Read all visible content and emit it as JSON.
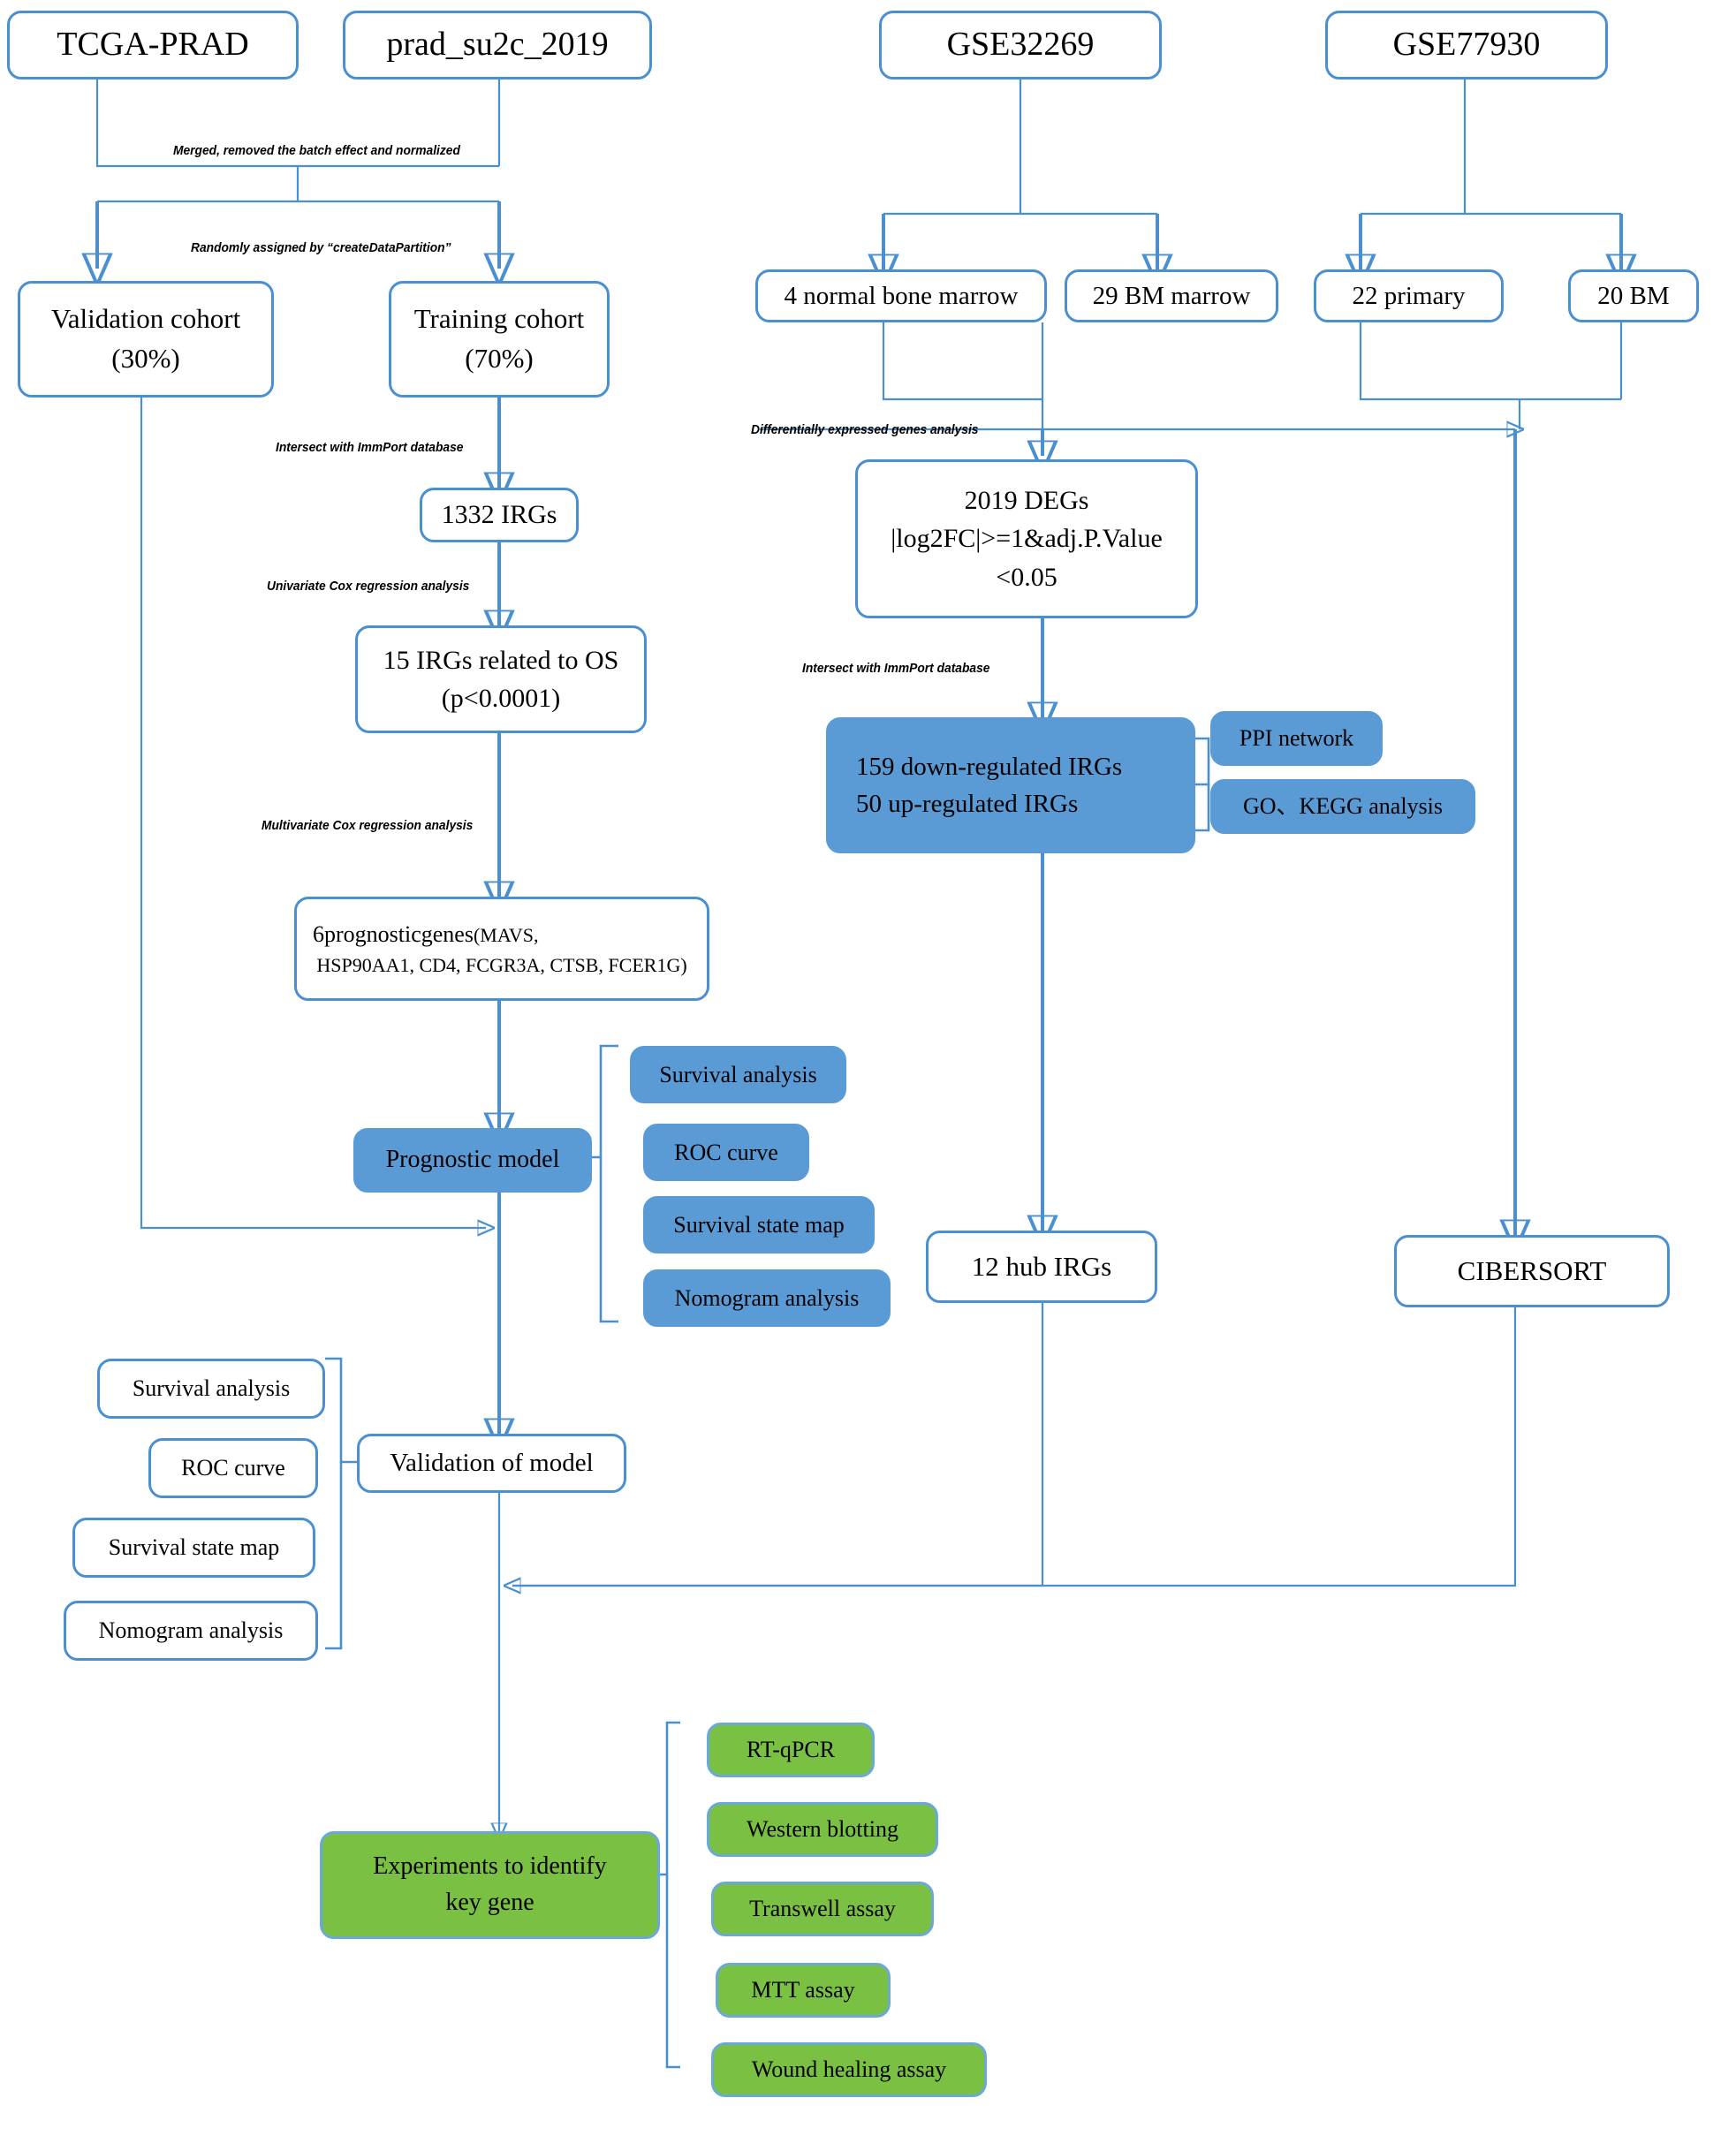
{
  "diagram": {
    "title": "Immune-related gene prognostic model workflow",
    "colors": {
      "connector": "#4a8fd0",
      "blue_box": "#5b9bd5",
      "green_box": "#7ac143",
      "white_box": "#ffffff",
      "text": "#000000"
    }
  },
  "sources": {
    "tcga_prad": "TCGA-PRAD",
    "prad_su2c_2019": "prad_su2c_2019",
    "gse32269": "GSE32269",
    "gse77930": "GSE77930"
  },
  "edge_labels": {
    "merged": "Merged, removed the batch effect and normalized",
    "random_partition": "Randomly assigned by “createDataPartition”",
    "intersect_immport_left": "Intersect with ImmPort database",
    "univariate_cox": "Univariate Cox regression analysis",
    "multivariate_cox": "Multivariate Cox regression analysis",
    "deg_analysis": "Differentially expressed genes analysis",
    "intersect_immport_right": "Intersect with ImmPort database"
  },
  "left_branch": {
    "validation_cohort": {
      "line1": "Validation cohort",
      "line2": "(30%)"
    },
    "training_cohort": {
      "line1": "Training cohort",
      "line2": "(70%)"
    },
    "irgs_1332": "1332 IRGs",
    "irgs_15": {
      "line1": "15 IRGs related to OS",
      "line2": "(p<0.0001)"
    },
    "prognostic_genes": {
      "line1_a": "6",
      "line1_b": "prognostic",
      "line1_c": "genes",
      "line1_d": "(MAVS,",
      "line2": "HSP90AA1, CD4, FCGR3A, CTSB, FCER1G)"
    },
    "prognostic_model": "Prognostic model",
    "model_outputs": [
      "Survival analysis",
      "ROC curve",
      "Survival state map",
      "Nomogram analysis"
    ],
    "validation_of_model": "Validation of model",
    "validation_outputs": [
      "Survival analysis",
      "ROC curve",
      "Survival state map",
      "Nomogram analysis"
    ]
  },
  "right_branch": {
    "gse32269_samples": [
      "4 normal bone marrow",
      "29 BM marrow"
    ],
    "gse77930_samples": [
      "22 primary",
      "20 BM"
    ],
    "degs": {
      "line1": "2019 DEGs",
      "line2": "|log2FC|>=1&adj.P.Value",
      "line3": "<0.05"
    },
    "regulated_irgs": {
      "line1": "159 down-regulated IRGs",
      "line2": "50 up-regulated IRGs"
    },
    "irg_analyses": [
      "PPI network",
      "GO、KEGG analysis"
    ],
    "hub_irgs": "12 hub IRGs",
    "cibersort": "CIBERSORT"
  },
  "experiments": {
    "main": {
      "line1": "Experiments to identify",
      "line2": "key gene"
    },
    "methods": [
      "RT-qPCR",
      "Western blotting",
      "Transwell assay",
      "MTT assay",
      "Wound healing assay"
    ]
  }
}
